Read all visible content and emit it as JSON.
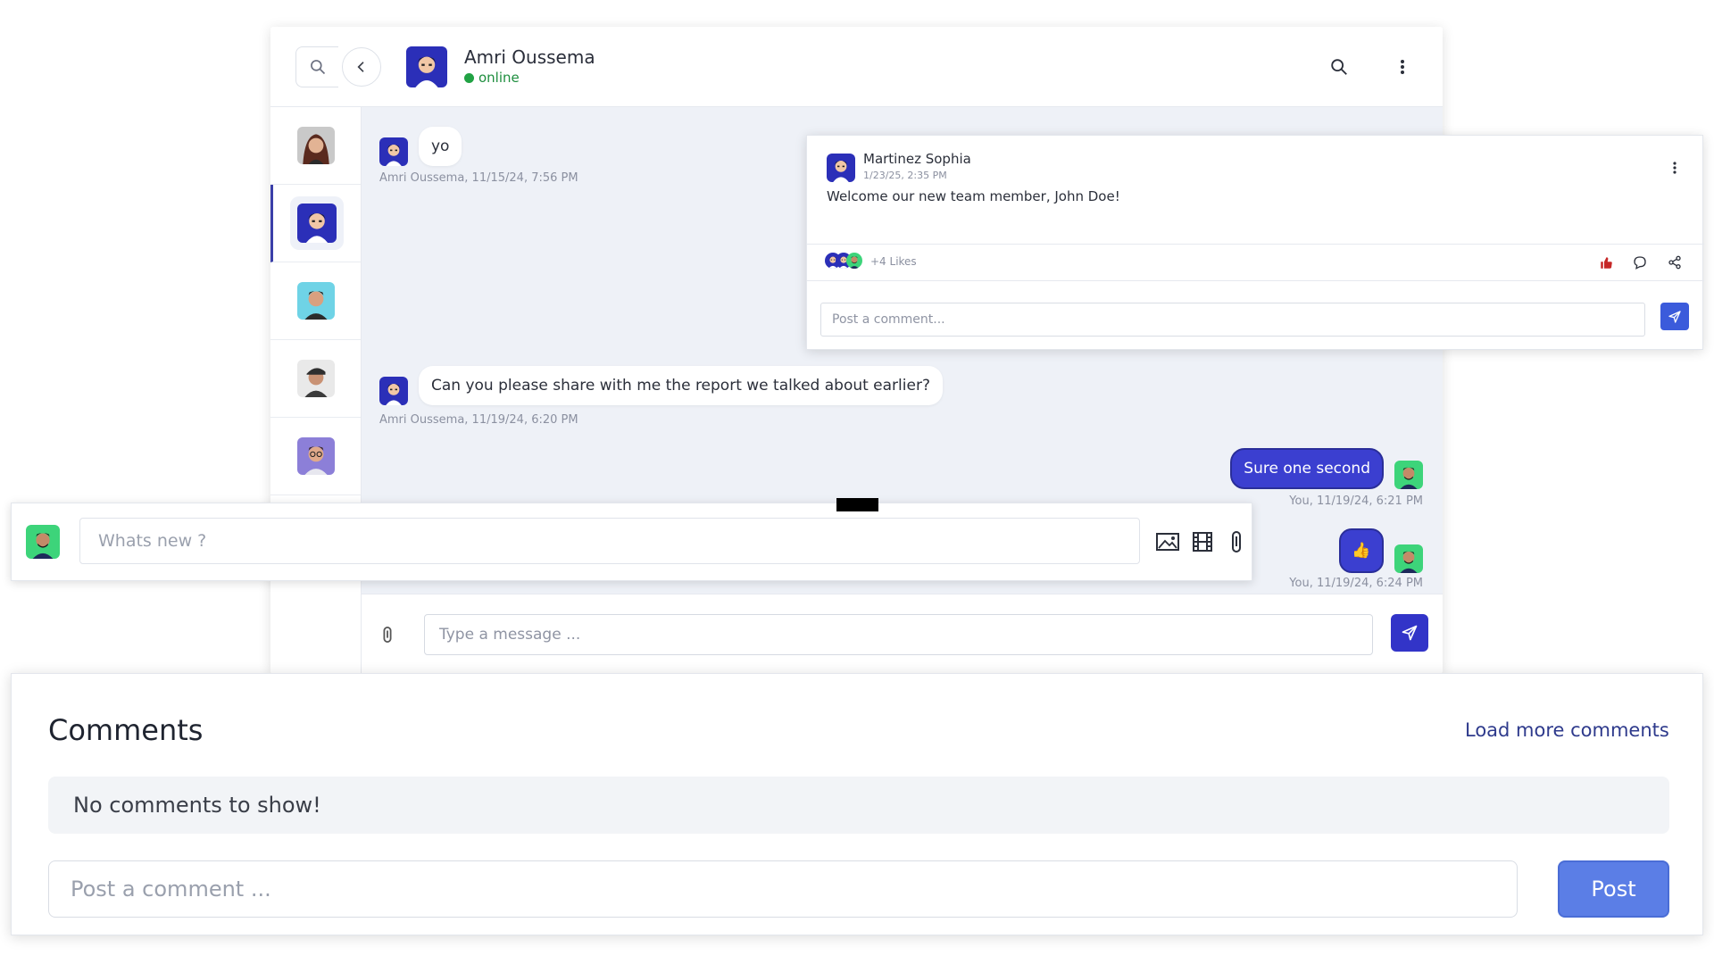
{
  "chat": {
    "contact_name": "Amri Oussema",
    "contact_status": "online",
    "messages": [
      {
        "text": "yo",
        "meta": "Amri Oussema, 11/15/24, 7:56 PM"
      },
      {
        "text": "Can you please share with me the report we talked about earlier?",
        "meta": "Amri Oussema, 11/19/24, 6:20 PM"
      },
      {
        "text": "Sure one second",
        "meta": "You, 11/19/24, 6:21 PM"
      },
      {
        "text": "👍",
        "meta": "You, 11/19/24, 6:24 PM"
      }
    ],
    "input_placeholder": "Type a message ..."
  },
  "post": {
    "author": "Martinez Sophia",
    "date": "1/23/25, 2:35 PM",
    "text": "Welcome our new team member, John Doe!",
    "likes": "+4 Likes",
    "comment_placeholder": "Post a comment..."
  },
  "new_post": {
    "placeholder": "Whats new ?"
  },
  "comments": {
    "title": "Comments",
    "load_more": "Load more comments",
    "empty": "No comments to show!",
    "input_placeholder": "Post a comment ...",
    "post_label": "Post"
  },
  "colors": {
    "accent": "#3234c8",
    "online": "#21a244",
    "bubble_out": "#3b3fd0",
    "post_button": "#5b7ee6"
  }
}
